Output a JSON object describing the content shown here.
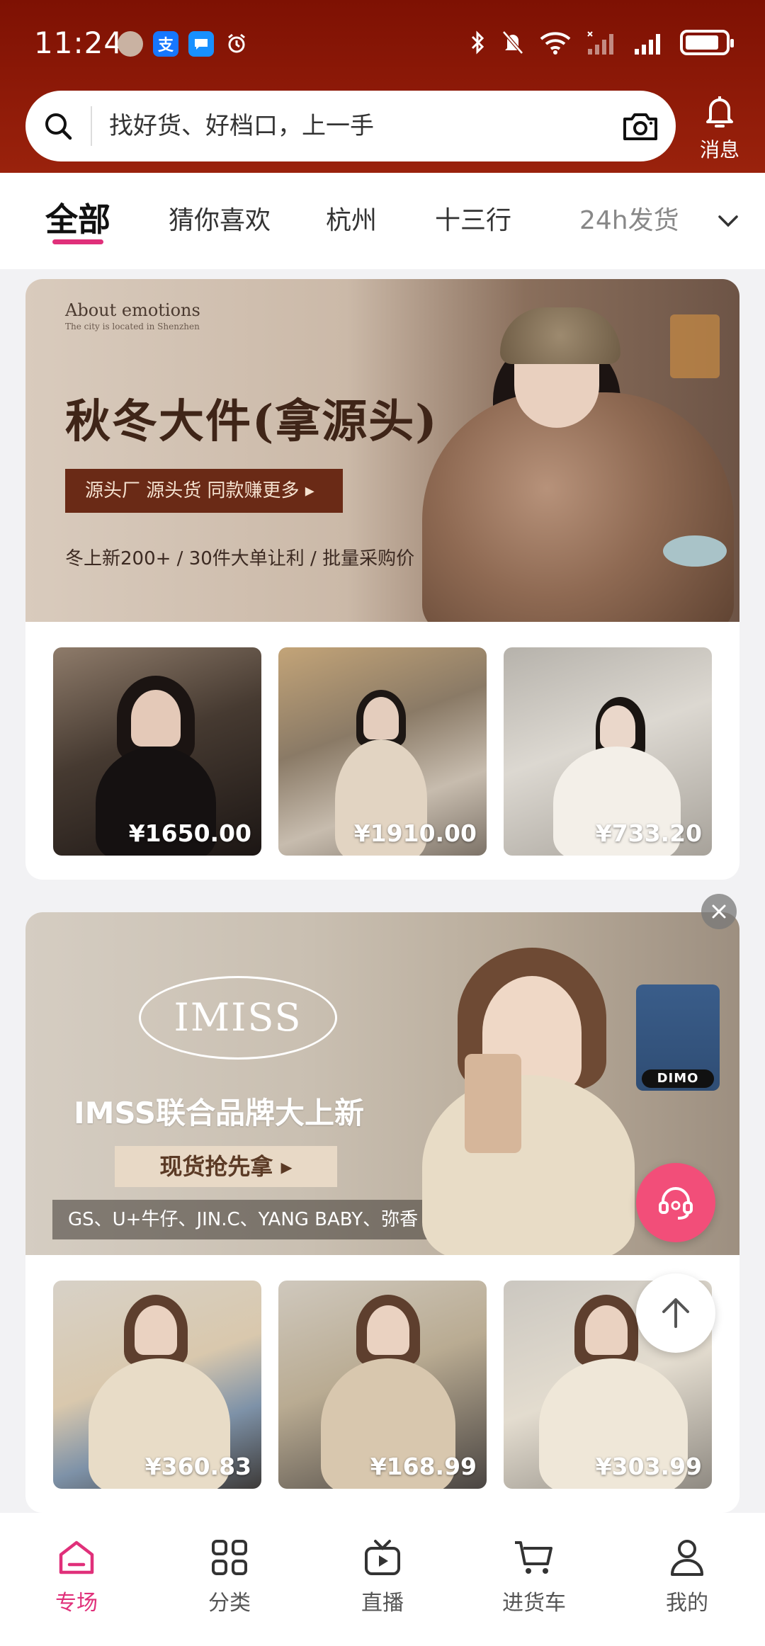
{
  "status_bar": {
    "time": "11:24"
  },
  "search": {
    "placeholder": "找好货、好档口，上一手",
    "messages_label": "消息"
  },
  "tabs": [
    "全部",
    "猜你喜欢",
    "杭州",
    "十三行",
    "24h发货"
  ],
  "banner1": {
    "brand_en": "About emotions",
    "brand_en_sub": "The city is located in Shenzhen",
    "title": "秋冬大件(拿源头)",
    "pill": "源头厂 源头货 同款赚更多 ▸",
    "subtitle": "冬上新200+ / 30件大单让利 / 批量采购价"
  },
  "products1": [
    {
      "price": "¥1650.00"
    },
    {
      "price": "¥1910.00"
    },
    {
      "price": "¥733.20"
    }
  ],
  "banner2": {
    "logo": "IMISS",
    "title": "IMSS联合品牌大上新",
    "pill": "现货抢先拿 ▸",
    "brands": "GS、U+牛仔、JIN.C、YANG BABY、弥香",
    "tag": "DIMO"
  },
  "products2": [
    {
      "price": "¥360.83"
    },
    {
      "price": "¥168.99"
    },
    {
      "price": "¥303.99"
    }
  ],
  "bottom_nav": [
    "专场",
    "分类",
    "直播",
    "进货车",
    "我的"
  ],
  "colors": {
    "header": "#8e1a08",
    "accent": "#e0307a",
    "fab": "#f24e79"
  }
}
